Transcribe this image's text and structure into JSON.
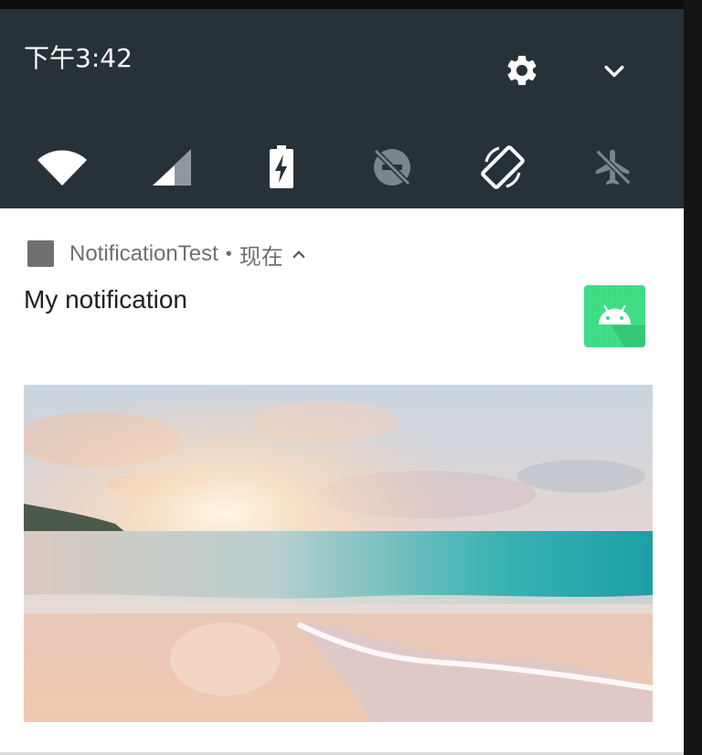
{
  "status": {
    "time": "下午3:42"
  },
  "quick_settings": {
    "icons": [
      "settings-gear-icon",
      "expand-chevron-icon"
    ],
    "tiles": [
      {
        "name": "wifi",
        "active": true
      },
      {
        "name": "cellular-signal",
        "active": true
      },
      {
        "name": "battery-charging",
        "active": true
      },
      {
        "name": "do-not-disturb",
        "active": false
      },
      {
        "name": "auto-rotate",
        "active": true
      },
      {
        "name": "airplane-mode",
        "active": false
      }
    ]
  },
  "notification": {
    "app_name": "NotificationTest",
    "separator": "•",
    "time": "现在",
    "title": "My notification",
    "large_icon": "android-robot-icon",
    "big_picture": "beach-sunset-image"
  },
  "colors": {
    "shade": "#263238",
    "card": "#ffffff",
    "app_icon_green": "#3ddc84"
  }
}
